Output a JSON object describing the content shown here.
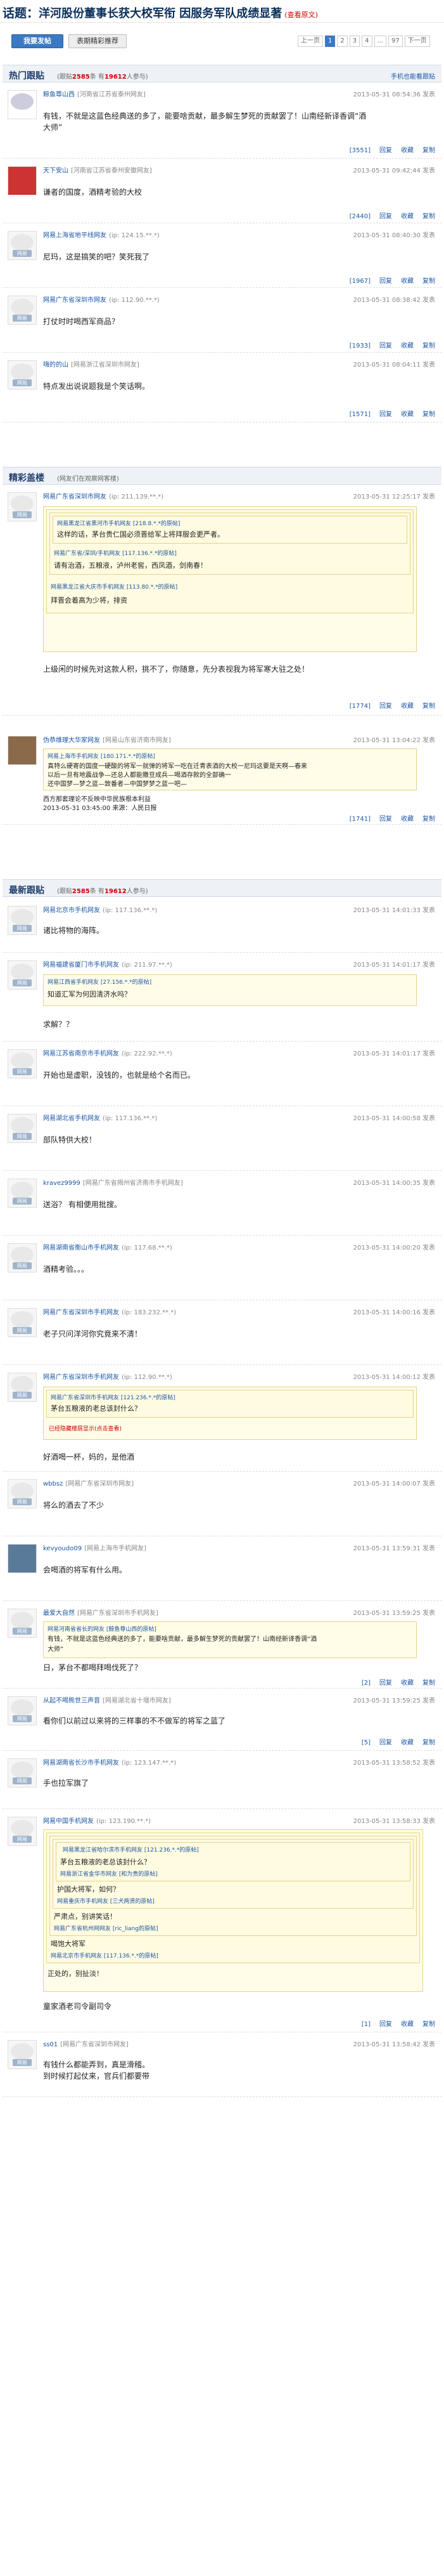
{
  "title": {
    "prefix": "话题：",
    "text": "洋河股份董事长获大校军衔 因服务军队成绩显著",
    "tag": "(查看原文)"
  },
  "toolbar": {
    "quick": "我要发帖",
    "sort": "表期精彩推荐",
    "pager": [
      "上一页",
      "1",
      "2",
      "3",
      "4",
      "...",
      "97",
      "下一页"
    ]
  },
  "hot": {
    "title": "热门跟贴",
    "stats_a": "(跟贴",
    "stats_num": "2585",
    "stats_b": "条 有",
    "stats_num2": "19612",
    "stats_c": "人参与)",
    "right": "手机也能看跟贴"
  },
  "featured": {
    "title": "精彩盖楼",
    "note": "(网友们在观察网客楼)"
  },
  "latest": {
    "title": "最新跟贴",
    "stats_a": "(跟贴",
    "stats_num": "2585",
    "stats_b": "条 有",
    "stats_num2": "19612",
    "stats_c": "人参与)"
  },
  "acts": {
    "report": "举报",
    "reply": "回复",
    "collect": "收藏",
    "share": "复制"
  },
  "avatar_text": "网易",
  "posts": [
    {
      "user": "鲸鱼尊山西",
      "ip": "[河南省江苏省泰州网友]",
      "time": "2013-05-31 08:54:36 发表",
      "body1": "有钱，不就是这蓝色经典送的多了，能要啥贡献，最多解生梦死的贡献罢了！山南经新译香调“酒",
      "body2": "大师”",
      "cnt": "[3551]"
    },
    {
      "user": "天下安山",
      "ip": "[河南省江苏省泰州安徽网友]",
      "time": "2013-05-31 09:42:44 发表",
      "body1": "谦者的国度，酒精考验的大校",
      "cnt": "[2440]"
    },
    {
      "user": "网易上海省地平线网友",
      "ip": "(ip: 124.15.**.*)",
      "time": "2013-05-31 08:40:30 发表",
      "body1": "尼玛，这是搞笑的吧？笑死我了",
      "cnt": "[1967]"
    },
    {
      "user": "网易广东省深圳市网友",
      "ip": "(ip: 112.90.**.*)",
      "time": "2013-05-31 08:38:42 发表",
      "body1": "打仗时时喝西军商品？",
      "cnt": "[1933]"
    },
    {
      "user": "嗨的的山",
      "ip": "[网易浙江省深圳市网友]",
      "time": "2013-05-31 08:04:11 发表",
      "body1": "特点发出说说题我是个笑话啊。",
      "cnt": "[1571]"
    },
    {
      "user": "网易广东省深圳市网友",
      "ip": "(ip: 211.139.**.*)",
      "time": "2013-05-31 12:25:17 发表",
      "q1h": "网易黑龙江省黑河市手机网友",
      "q1ip": "[218.8.*.*的原帖]",
      "q1b": "这样的话，茅台贵仁国必须晋给军上将拜服会更严者。",
      "q2h": "网易广东省/深圳/手机网友",
      "q2ip": "[117.136.*.*的原帖]",
      "q2b": "请有治酒，五粮液，泸州老窖，西凤酒，剑南春！",
      "q3h": "网易黑龙江省大庆市手机网友",
      "q3ip": "[113.80.*.*的原帖]",
      "q3b": "拜晋会着高为少将，排资",
      "body1": "上级闲的时候先对这款人积，挑不了，你随意，先分表视我为将军寒大驻之处！",
      "cnt": "[1774]"
    },
    {
      "user": "网易上海市手机网友",
      "ip": "(ip: 117.136.**.*)",
      "time": "2013-05-31 12:55:17 发表",
      "body1": "喝酒喝十一点多",
      "cnt": "[2112]"
    },
    {
      "user": "伪恭维理大华家网友",
      "ip": "[网易山东省济南市网友]",
      "time": "2013-05-31 13:04:22 发表",
      "q1h": "网易上海市手机网友",
      "q1ip": "[180.171.*.*的原帖]",
      "q1b": "真特么硬寄的国度一硬酸的将军一就弹的将军一吃在迁青表酒的大校一尼玛这要是天啊—春来",
      "q1b2": "以后一旦有地震战争—还总人都能撒豆成兵—喝酒存款的全部确一",
      "q1b3": "还中国梦—梦之蓝—致番者—中国梦梦之蓝一吧—",
      "body1": "西方那套理论不反映中华民族根本利益",
      "body2": "2013-05-31 03:45:00  来源：人民日报",
      "cnt": "[1741]"
    },
    {
      "user": "网易北京市手机网友",
      "ip": "(ip: 117.136.**.*)",
      "time": "2013-05-31 14:01:33 发表",
      "body1": "诸比将物的海阵。"
    },
    {
      "user": "网易福建省厦门市手机网友",
      "ip": "(ip: 211.97.**.*)",
      "time": "2013-05-31 14:01:17 发表",
      "q1h": "网易江西省手机网友",
      "q1ip": "[27.156.*.*的原帖]",
      "q1b": "知道汇军为何因清济水吗？",
      "body1": "求解？？"
    },
    {
      "user": "网易江苏省南京市手机网友",
      "ip": "(ip: 222.92.**.*)",
      "time": "2013-05-31 14:01:17 发表",
      "body1": "开始也是虚职，没钱的，也就是给个名而已。"
    },
    {
      "user": "网易湖北省手机网友",
      "ip": "(ip: 117.136.**.*)",
      "time": "2013-05-31 14:00:58 发表",
      "body1": "部队特供大校！"
    },
    {
      "user": "kravez9999",
      "ip": "[网易广东省揭州省济南市手机网友]",
      "time": "2013-05-31 14:00:35 发表",
      "body1": "送浴？ 有相便用批搜。"
    },
    {
      "user": "网易湖南省衡山市手机网友",
      "ip": "(ip: 117.68.**.*)",
      "time": "2013-05-31 14:00:20 发表",
      "body1": "酒精考验。。。"
    },
    {
      "user": "网易广东省深圳市手机网友",
      "ip": "(ip: 183.232.**.*)",
      "time": "2013-05-31 14:00:16 发表",
      "body1": "老子只问洋河你究竟来不清！"
    },
    {
      "user": "网易广东省深圳市手机网友",
      "ip": "(ip: 112.90.**.*)",
      "time": "2013-05-31 14:00:12 发表",
      "q1h": "网易广东省深圳市手机网友",
      "q1ip": "[121.236.*.*的原帖]",
      "q1b": "茅台五粮液的老总该封什么？",
      "qnote": "已经隐藏楼层显示(点击查看)",
      "body1": "好酒喝一杯，妈的，是他酒"
    },
    {
      "user": "wbbsz",
      "ip": "[网易广东省深圳市网友]",
      "time": "2013-05-31 14:00:07 发表",
      "body1": "将么的酒去了不少"
    },
    {
      "user": "kevyoudo09",
      "ip": "[网易上海市手机网友]",
      "time": "2013-05-31 13:59:31 发表",
      "body1": "会喝酒的将军有什么用。"
    },
    {
      "user": "最爱大自然",
      "ip": "[网易广东省深圳市手机网友]",
      "time": "2013-05-31 13:59:25 发表",
      "q1h": "网易河南省省长的网友",
      "q1ip": "[鲸鱼尊山西的原帖]",
      "q1b": "有钱，不就是这蓝色经典送的多了，能要啥贡献，最多解生梦死的贡献罢了！山南经新译香调“酒",
      "q1b2": "大师”",
      "body1": "日，茅台不都喝拜喝伐死了？",
      "cnt": "[2]"
    },
    {
      "user": "从起不喝熊世三声音",
      "ip": "[网易湖北省十堰市网友]",
      "time": "2013-05-31 13:59:25 发表",
      "body1": "看你们以前过以来将的三样事的不不做军的将军之蓝了",
      "cnt": "[5]"
    },
    {
      "user": "网易湖南省长沙市手机网友",
      "ip": "(ip: 123.147.**.*)",
      "time": "2013-05-31 13:58:52 发表",
      "body1": "手也拉军旗了"
    },
    {
      "user": "网易中国手机网友",
      "ip": "(ip: 123.190.**.*)",
      "time": "2013-05-31 13:58:33 发表",
      "q1h": "网易黑龙江省哈尔滨市手机网友",
      "q1ip": "[121.236.*.*的原帖]",
      "q1b": "茅台五粮液的老总该封什么？",
      "q2h": "网易浙江省金华市网友",
      "q2ip": "[和为贵的原帖]",
      "q2b": "护国大将军，如何？",
      "q3h": "网易重庆市手机网友",
      "q3ip": "[三犬两贤的原帖]",
      "q3b": "严肃点，别讲笑话！",
      "q4h": "网易广东省杭州网网友",
      "q4ip": "[ric_liang的原帖]",
      "q4b": "喝饱大将军",
      "q5h": "网易北京市手机网友",
      "q5ip": "[117.136.*.*的原帖]",
      "q5b": "正处的，别扯淡！",
      "body1": "童家酒老司令副司令",
      "cnt": "[1]"
    },
    {
      "user": "ss01",
      "ip": "[网易广东省深圳市网友]",
      "time": "2013-05-31 13:58:42 发表",
      "body1": "有钱什么都能弄到，真是滑稽。",
      "body2": "到时候打起仗来，官兵们都要带"
    }
  ]
}
